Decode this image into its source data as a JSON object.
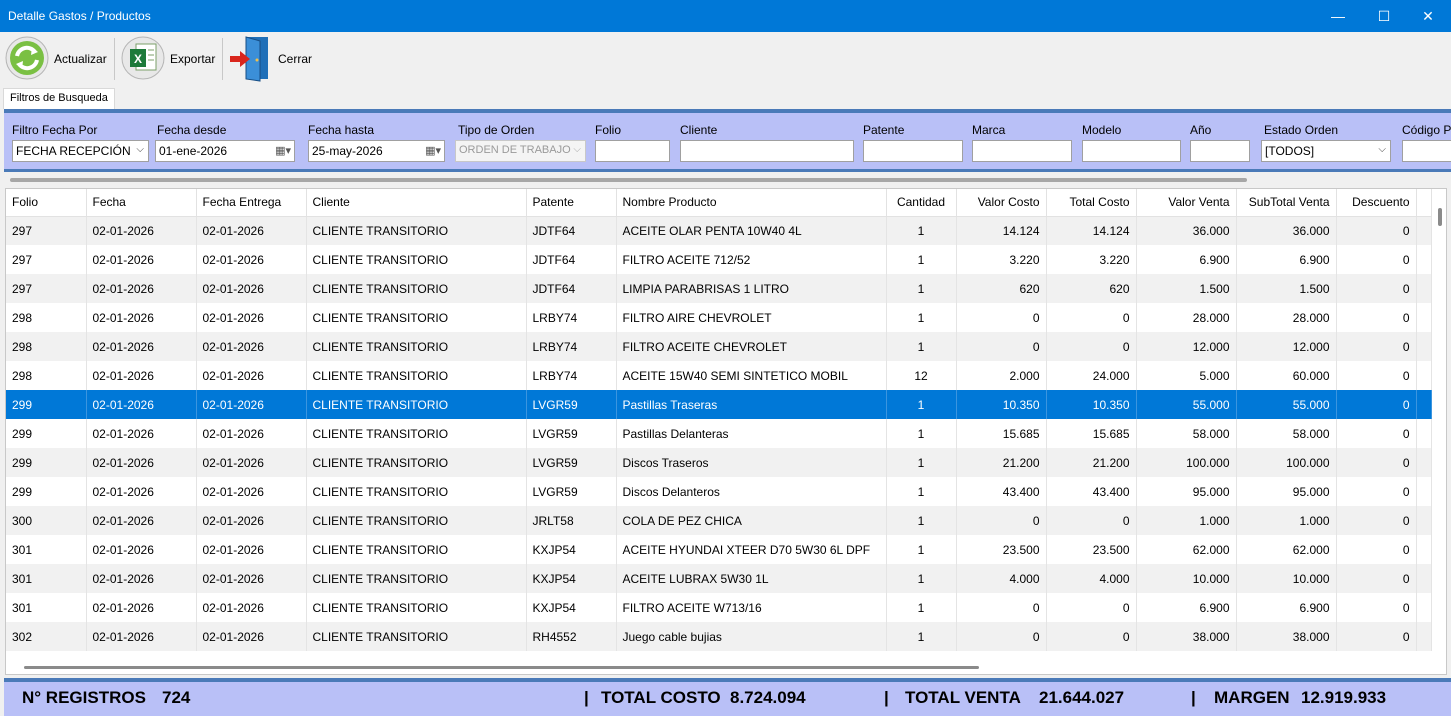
{
  "window": {
    "title": "Detalle Gastos / Productos",
    "minimize": "—",
    "maximize": "☐",
    "close": "✕"
  },
  "toolbar": {
    "refresh_label": "Actualizar",
    "export_label": "Exportar",
    "close_label": "Cerrar"
  },
  "tab": {
    "label": "Filtros de Busqueda"
  },
  "filters": {
    "filtro_fecha_label": "Filtro Fecha Por",
    "filtro_fecha_value": "FECHA RECEPCIÓN",
    "fecha_desde_label": "Fecha desde",
    "fecha_desde_value": "01-ene-2026",
    "fecha_hasta_label": "Fecha hasta",
    "fecha_hasta_value": "25-may-2026",
    "tipo_orden_label": "Tipo de Orden",
    "tipo_orden_value": "ORDEN DE TRABAJO",
    "folio_label": "Folio",
    "folio_value": "",
    "cliente_label": "Cliente",
    "cliente_value": "",
    "patente_label": "Patente",
    "patente_value": "",
    "marca_label": "Marca",
    "marca_value": "",
    "modelo_label": "Modelo",
    "modelo_value": "",
    "anio_label": "Año",
    "anio_value": "",
    "estado_label": "Estado Orden",
    "estado_value": "[TODOS]",
    "codigo_label": "Código P"
  },
  "table": {
    "columns": [
      "Folio",
      "Fecha",
      "Fecha Entrega",
      "Cliente",
      "Patente",
      "Nombre Producto",
      "Cantidad",
      "Valor Costo",
      "Total Costo",
      "Valor Venta",
      "SubTotal Venta",
      "Descuento"
    ],
    "rows": [
      [
        "297",
        "02-01-2026",
        "02-01-2026",
        "CLIENTE TRANSITORIO",
        "JDTF64",
        "ACEITE OLAR PENTA 10W40 4L",
        "1",
        "14.124",
        "14.124",
        "36.000",
        "36.000",
        "0"
      ],
      [
        "297",
        "02-01-2026",
        "02-01-2026",
        "CLIENTE TRANSITORIO",
        "JDTF64",
        "FILTRO ACEITE 712/52",
        "1",
        "3.220",
        "3.220",
        "6.900",
        "6.900",
        "0"
      ],
      [
        "297",
        "02-01-2026",
        "02-01-2026",
        "CLIENTE TRANSITORIO",
        "JDTF64",
        "LIMPIA PARABRISAS 1 LITRO",
        "1",
        "620",
        "620",
        "1.500",
        "1.500",
        "0"
      ],
      [
        "298",
        "02-01-2026",
        "02-01-2026",
        "CLIENTE TRANSITORIO",
        "LRBY74",
        "FILTRO AIRE CHEVROLET",
        "1",
        "0",
        "0",
        "28.000",
        "28.000",
        "0"
      ],
      [
        "298",
        "02-01-2026",
        "02-01-2026",
        "CLIENTE TRANSITORIO",
        "LRBY74",
        "FILTRO ACEITE CHEVROLET",
        "1",
        "0",
        "0",
        "12.000",
        "12.000",
        "0"
      ],
      [
        "298",
        "02-01-2026",
        "02-01-2026",
        "CLIENTE TRANSITORIO",
        "LRBY74",
        "ACEITE 15W40 SEMI SINTETICO MOBIL",
        "12",
        "2.000",
        "24.000",
        "5.000",
        "60.000",
        "0"
      ],
      [
        "299",
        "02-01-2026",
        "02-01-2026",
        "CLIENTE TRANSITORIO",
        "LVGR59",
        "Pastillas Traseras",
        "1",
        "10.350",
        "10.350",
        "55.000",
        "55.000",
        "0"
      ],
      [
        "299",
        "02-01-2026",
        "02-01-2026",
        "CLIENTE TRANSITORIO",
        "LVGR59",
        "Pastillas Delanteras",
        "1",
        "15.685",
        "15.685",
        "58.000",
        "58.000",
        "0"
      ],
      [
        "299",
        "02-01-2026",
        "02-01-2026",
        "CLIENTE TRANSITORIO",
        "LVGR59",
        "Discos Traseros",
        "1",
        "21.200",
        "21.200",
        "100.000",
        "100.000",
        "0"
      ],
      [
        "299",
        "02-01-2026",
        "02-01-2026",
        "CLIENTE TRANSITORIO",
        "LVGR59",
        "Discos Delanteros",
        "1",
        "43.400",
        "43.400",
        "95.000",
        "95.000",
        "0"
      ],
      [
        "300",
        "02-01-2026",
        "02-01-2026",
        "CLIENTE TRANSITORIO",
        "JRLT58",
        "COLA DE PEZ CHICA",
        "1",
        "0",
        "0",
        "1.000",
        "1.000",
        "0"
      ],
      [
        "301",
        "02-01-2026",
        "02-01-2026",
        "CLIENTE TRANSITORIO",
        "KXJP54",
        "ACEITE HYUNDAI XTEER D70 5W30 6L DPF",
        "1",
        "23.500",
        "23.500",
        "62.000",
        "62.000",
        "0"
      ],
      [
        "301",
        "02-01-2026",
        "02-01-2026",
        "CLIENTE TRANSITORIO",
        "KXJP54",
        "ACEITE LUBRAX 5W30 1L",
        "1",
        "4.000",
        "4.000",
        "10.000",
        "10.000",
        "0"
      ],
      [
        "301",
        "02-01-2026",
        "02-01-2026",
        "CLIENTE TRANSITORIO",
        "KXJP54",
        "FILTRO ACEITE W713/16",
        "1",
        "0",
        "0",
        "6.900",
        "6.900",
        "0"
      ],
      [
        "302",
        "02-01-2026",
        "02-01-2026",
        "CLIENTE TRANSITORIO",
        "RH4552",
        "Juego cable bujias",
        "1",
        "0",
        "0",
        "38.000",
        "38.000",
        "0"
      ]
    ],
    "selected_row": 6
  },
  "status": {
    "registros_label": "N° REGISTROS",
    "registros_value": "724",
    "total_costo_label": "TOTAL COSTO",
    "total_costo_value": "8.724.094",
    "total_venta_label": "TOTAL VENTA",
    "total_venta_value": "21.644.027",
    "margen_label": "MARGEN",
    "margen_value": "12.919.933",
    "separator": "|"
  },
  "colors": {
    "titlebar": "#0078d7",
    "filter_bg": "#b9c0f7",
    "selection": "#0078d7",
    "accent_border": "#4a7ab8"
  }
}
